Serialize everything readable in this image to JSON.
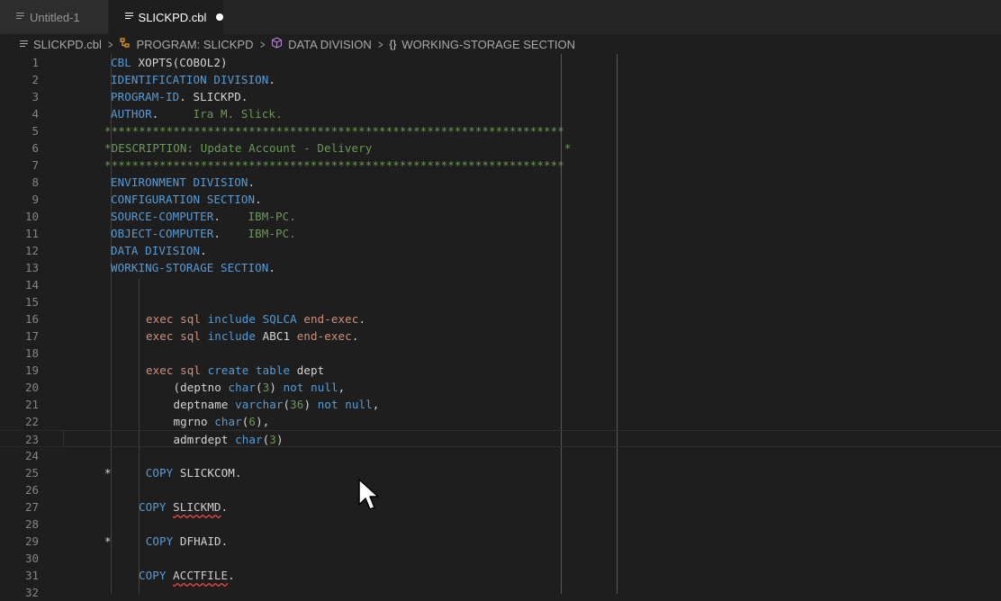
{
  "tabs": [
    {
      "label": "Untitled-1"
    },
    {
      "label": "SLICKPD.cbl"
    }
  ],
  "breadcrumb": {
    "file": "SLICKPD.cbl",
    "program": "PROGRAM: SLICKPD",
    "division": "DATA DIVISION",
    "section": "WORKING-STORAGE SECTION"
  },
  "editor": {
    "active_line": 23,
    "lines": [
      {
        "n": "1",
        "segs": [
          [
            "kw",
            "CBL "
          ],
          [
            "plain",
            "XOPTS(COBOL2)"
          ]
        ]
      },
      {
        "n": "2",
        "segs": [
          [
            "kw",
            "IDENTIFICATION DIVISION"
          ],
          [
            "plain",
            "."
          ]
        ]
      },
      {
        "n": "3",
        "segs": [
          [
            "kw",
            "PROGRAM-ID"
          ],
          [
            "plain",
            ". SLICKPD."
          ]
        ]
      },
      {
        "n": "4",
        "segs": [
          [
            "kw",
            "AUTHOR"
          ],
          [
            "plain",
            ".     "
          ],
          [
            "lit",
            "Ira M. Slick."
          ]
        ]
      },
      {
        "n": "5",
        "segs": [
          [
            "cm",
            "*******************************************************************"
          ]
        ]
      },
      {
        "n": "6",
        "segs": [
          [
            "cm",
            "*DESCRIPTION: Update Account - Delivery                            *"
          ]
        ]
      },
      {
        "n": "7",
        "segs": [
          [
            "cm",
            "*******************************************************************"
          ]
        ]
      },
      {
        "n": "8",
        "segs": [
          [
            "kw",
            "ENVIRONMENT DIVISION"
          ],
          [
            "plain",
            "."
          ]
        ]
      },
      {
        "n": "9",
        "segs": [
          [
            "kw",
            "CONFIGURATION SECTION"
          ],
          [
            "plain",
            "."
          ]
        ]
      },
      {
        "n": "10",
        "segs": [
          [
            "kw",
            "SOURCE-COMPUTER"
          ],
          [
            "plain",
            ".    "
          ],
          [
            "lit",
            "IBM-PC."
          ]
        ]
      },
      {
        "n": "11",
        "segs": [
          [
            "kw",
            "OBJECT-COMPUTER"
          ],
          [
            "plain",
            ".    "
          ],
          [
            "lit",
            "IBM-PC."
          ]
        ]
      },
      {
        "n": "12",
        "segs": [
          [
            "kw",
            "DATA DIVISION"
          ],
          [
            "plain",
            "."
          ]
        ]
      },
      {
        "n": "13",
        "segs": [
          [
            "kw",
            "WORKING-STORAGE SECTION"
          ],
          [
            "plain",
            "."
          ]
        ]
      },
      {
        "n": "14",
        "segs": []
      },
      {
        "n": "15",
        "segs": []
      },
      {
        "n": "16",
        "segs": [
          [
            "ex",
            "exec sql "
          ],
          [
            "kw",
            "include "
          ],
          [
            "kw",
            "SQLCA "
          ],
          [
            "ex",
            "end-exec"
          ],
          [
            "plain",
            "."
          ]
        ]
      },
      {
        "n": "17",
        "segs": [
          [
            "ex",
            "exec sql "
          ],
          [
            "kw",
            "include "
          ],
          [
            "plain",
            "ABC1 "
          ],
          [
            "ex",
            "end-exec"
          ],
          [
            "plain",
            "."
          ]
        ]
      },
      {
        "n": "18",
        "segs": []
      },
      {
        "n": "19",
        "segs": [
          [
            "ex",
            "exec sql "
          ],
          [
            "kw",
            "create table "
          ],
          [
            "plain",
            "dept"
          ]
        ]
      },
      {
        "n": "20",
        "segs": [
          [
            "plain",
            "    ("
          ],
          [
            "plain",
            "deptno "
          ],
          [
            "kw",
            "char"
          ],
          [
            "plain",
            "("
          ],
          [
            "lit",
            "3"
          ],
          [
            "plain",
            ") "
          ],
          [
            "kw",
            "not null"
          ],
          [
            "plain",
            ","
          ]
        ]
      },
      {
        "n": "21",
        "segs": [
          [
            "plain",
            "    deptname "
          ],
          [
            "kw",
            "varchar"
          ],
          [
            "plain",
            "("
          ],
          [
            "lit",
            "36"
          ],
          [
            "plain",
            ") "
          ],
          [
            "kw",
            "not null"
          ],
          [
            "plain",
            ","
          ]
        ]
      },
      {
        "n": "22",
        "segs": [
          [
            "plain",
            "    mgrno "
          ],
          [
            "kw",
            "char"
          ],
          [
            "plain",
            "("
          ],
          [
            "lit",
            "6"
          ],
          [
            "plain",
            "),"
          ]
        ]
      },
      {
        "n": "23",
        "segs": [
          [
            "plain",
            "    admrdept "
          ],
          [
            "kw",
            "char"
          ],
          [
            "plain",
            "("
          ],
          [
            "lit",
            "3"
          ],
          [
            "plain",
            ")"
          ]
        ]
      },
      {
        "n": "24",
        "segs": []
      },
      {
        "n": "25",
        "segs": [
          [
            "plain",
            "*     "
          ],
          [
            "kw",
            "COPY "
          ],
          [
            "plain",
            "SLICKCOM."
          ]
        ]
      },
      {
        "n": "26",
        "segs": []
      },
      {
        "n": "27",
        "segs": [
          [
            "kw",
            "COPY "
          ],
          [
            "squig",
            "SLICKMD"
          ],
          [
            "plain",
            "."
          ]
        ]
      },
      {
        "n": "28",
        "segs": []
      },
      {
        "n": "29",
        "segs": [
          [
            "plain",
            "*     "
          ],
          [
            "kw",
            "COPY "
          ],
          [
            "plain",
            "DFHAID."
          ]
        ]
      },
      {
        "n": "30",
        "segs": []
      },
      {
        "n": "31",
        "segs": [
          [
            "kw",
            "COPY "
          ],
          [
            "squig",
            "ACCTFILE"
          ],
          [
            "plain",
            "."
          ]
        ]
      },
      {
        "n": "32",
        "segs": []
      }
    ]
  }
}
